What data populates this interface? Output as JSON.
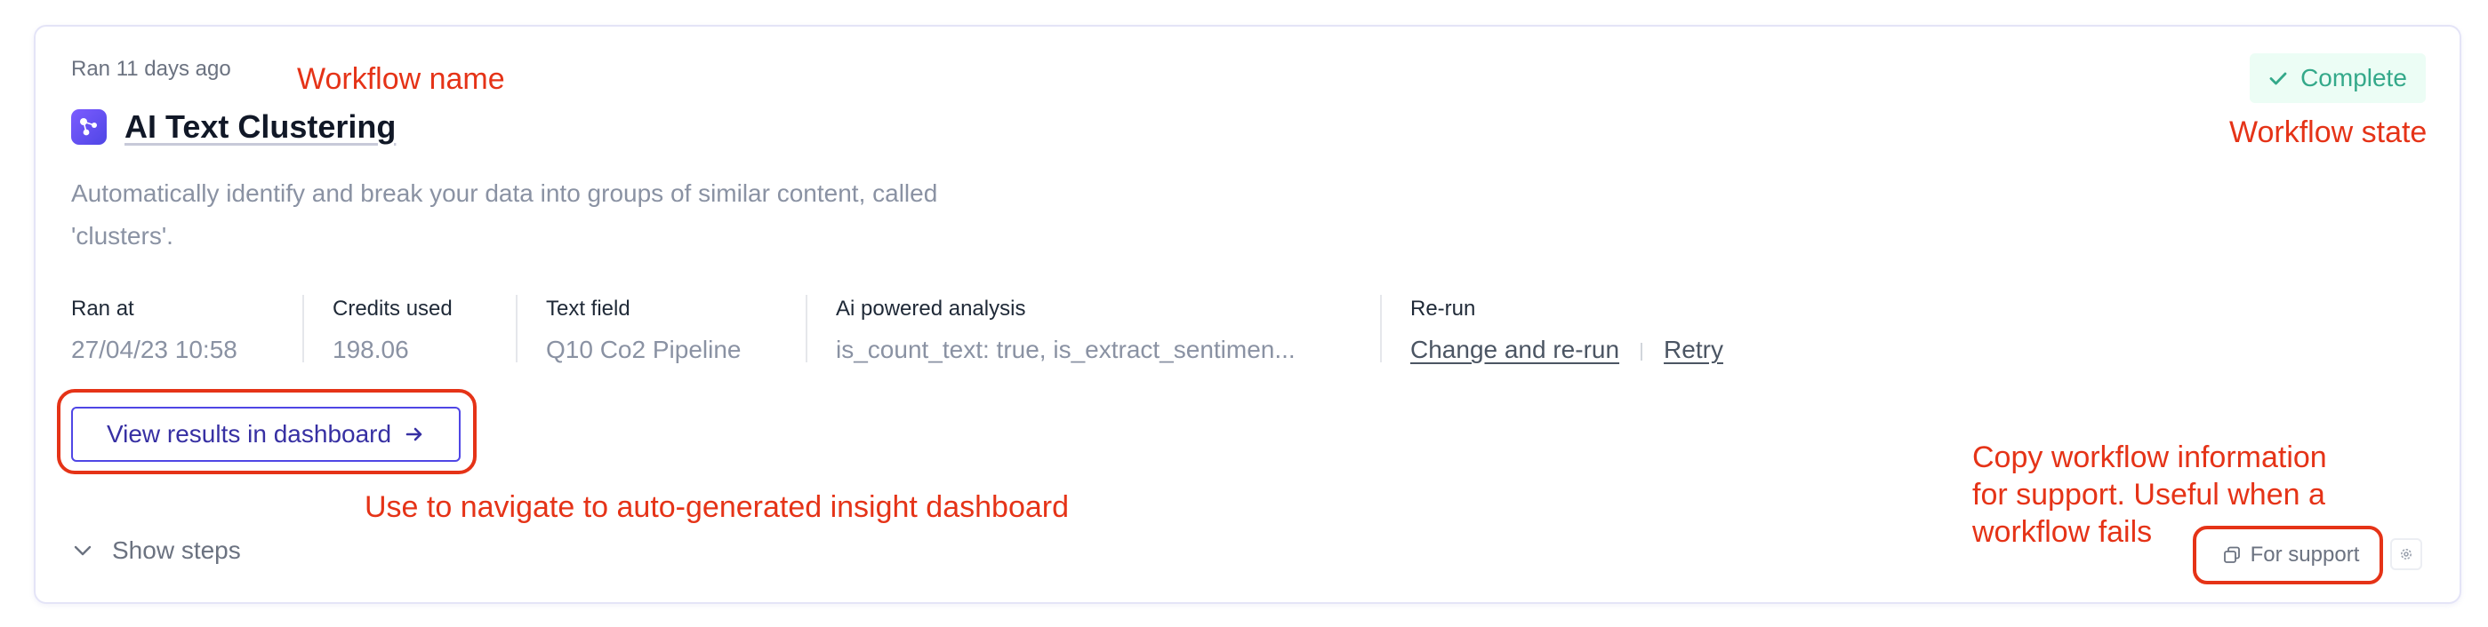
{
  "workflow": {
    "ran_ago": "Ran 11 days ago",
    "title": "AI Text Clustering",
    "description": "Automatically identify and break your data into groups of similar content, called 'clusters'.",
    "status": "Complete"
  },
  "meta": {
    "ran_at": {
      "label": "Ran at",
      "value": "27/04/23 10:58"
    },
    "credits_used": {
      "label": "Credits used",
      "value": "198.06"
    },
    "text_field": {
      "label": "Text field",
      "value": "Q10 Co2 Pipeline"
    },
    "ai_analysis": {
      "label": "Ai powered analysis",
      "value": "is_count_text: true, is_extract_sentimen..."
    },
    "rerun": {
      "label": "Re-run",
      "change_link": "Change and re-run",
      "retry_link": "Retry"
    }
  },
  "actions": {
    "view_results": "View results in dashboard",
    "show_steps": "Show steps",
    "for_support": "For support"
  },
  "annotations": {
    "workflow_name": "Workflow name",
    "workflow_state": "Workflow state",
    "dashboard_note": "Use to navigate to auto-generated insight dashboard",
    "support_note_1": "Copy workflow information",
    "support_note_2": "for support. Useful when a",
    "support_note_3": "workflow fails"
  },
  "colors": {
    "accent": "#4f46e5",
    "status_green": "#34a98a",
    "annotation_red": "#e53317"
  },
  "icons": {
    "workflow": "workflow-icon",
    "arrow": "arrow-right-icon",
    "chevron": "chevron-down-icon",
    "check": "check-icon",
    "copy": "copy-icon",
    "gear": "gear-icon"
  }
}
